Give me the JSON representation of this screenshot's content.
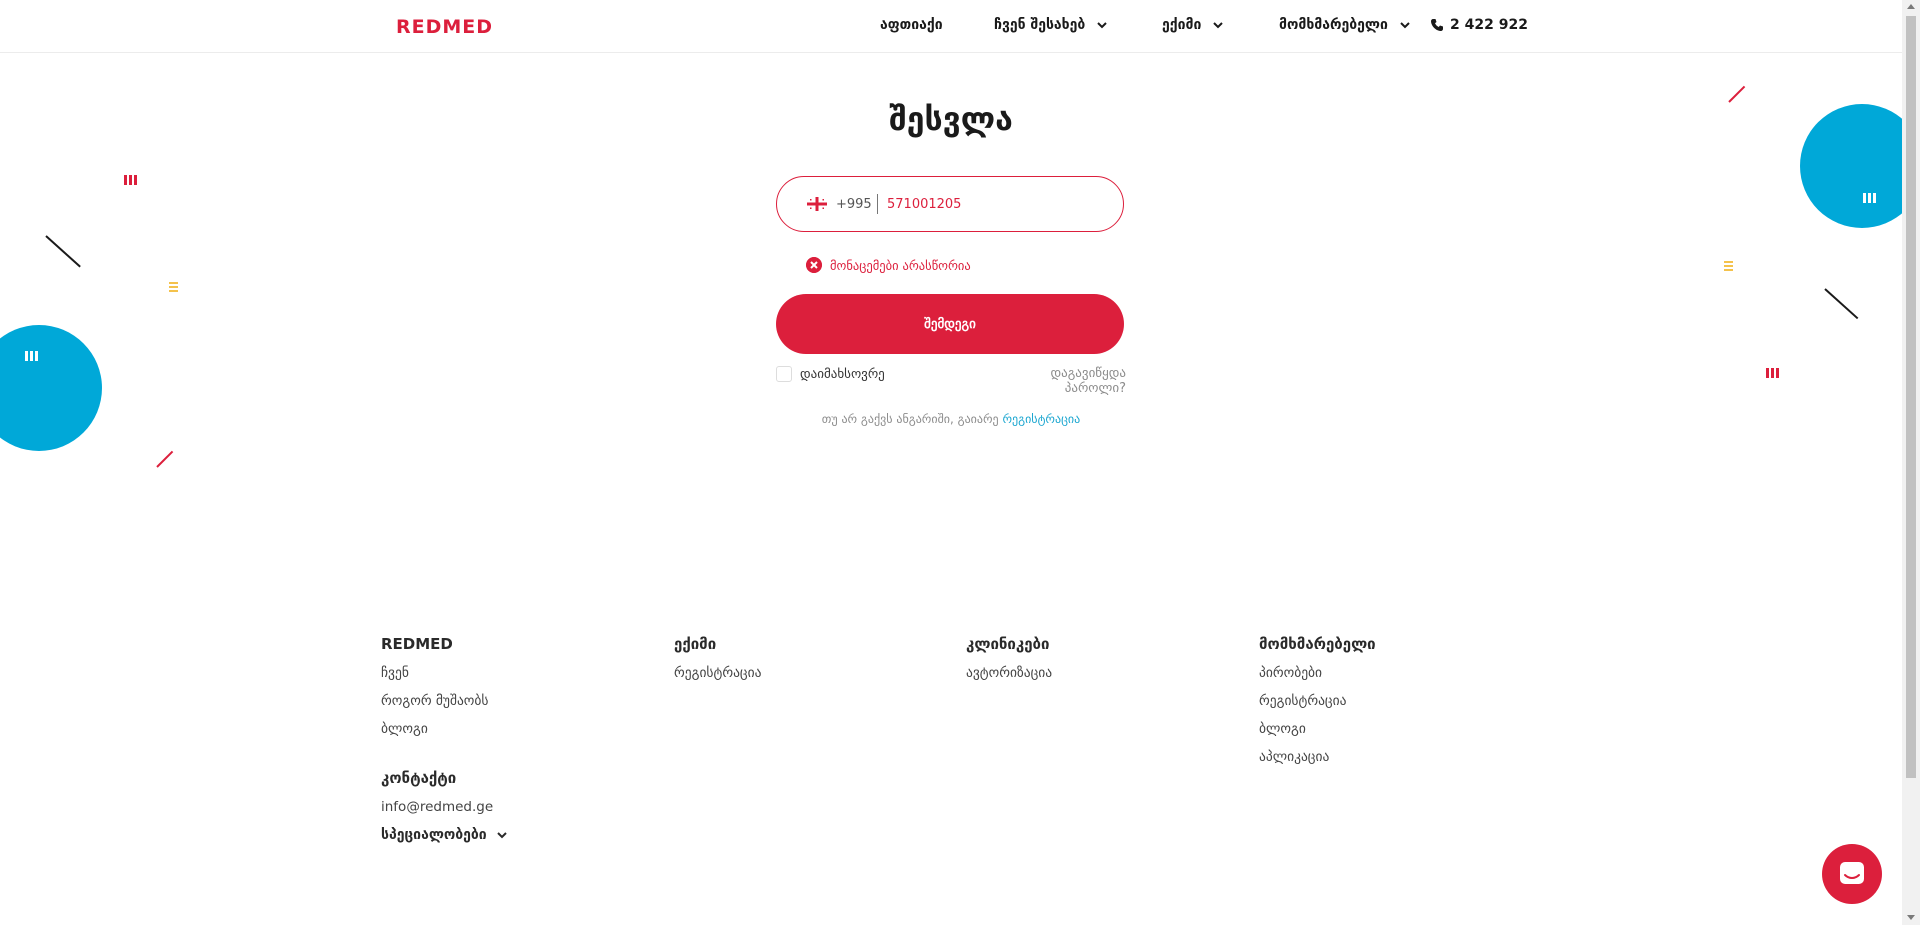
{
  "header": {
    "logo": "REDMED",
    "nav": [
      {
        "label": "აფთიაქი",
        "dropdown": false
      },
      {
        "label": "ჩვენ შესახებ",
        "dropdown": true
      },
      {
        "label": "ექიმი",
        "dropdown": true
      },
      {
        "label": "მომხმარებელი",
        "dropdown": true
      }
    ],
    "phone": "2 422 922"
  },
  "login": {
    "title": "შესვლა",
    "country_code": "+995",
    "phone_value": "571001205",
    "error": "მონაცემები არასწორია",
    "submit_label": "შემდეგი",
    "remember_label": "დაიმახსოვრე",
    "forgot_label": "დაგავიწყდა პაროლი?",
    "no_account_text": "თუ არ გაქვს ანგარიში, გაიარე",
    "register_link": "რეგისტრაცია"
  },
  "footer": {
    "columns": [
      {
        "title": "REDMED",
        "links": [
          "ჩვენ",
          "როგორ მუშაობს",
          "ბლოგი"
        ]
      },
      {
        "title": "ექიმი",
        "links": [
          "რეგისტრაცია"
        ]
      },
      {
        "title": "კლინიკები",
        "links": [
          "ავტორიზაცია"
        ]
      },
      {
        "title": "მომხმარებელი",
        "links": [
          "პირობები",
          "რეგისტრაცია",
          "ბლოგი",
          "აპლიკაცია"
        ]
      }
    ],
    "contact_title": "კონტაქტი",
    "email": "info@redmed.ge",
    "specialties_label": "სპეციალობები"
  },
  "colors": {
    "brand_red": "#dc1f3c",
    "accent_blue": "#00a8d8",
    "accent_yellow": "#f4c24c"
  },
  "icons": [
    "chevron-down-icon",
    "phone-icon",
    "georgia-flag-icon",
    "error-icon",
    "chat-icon"
  ]
}
